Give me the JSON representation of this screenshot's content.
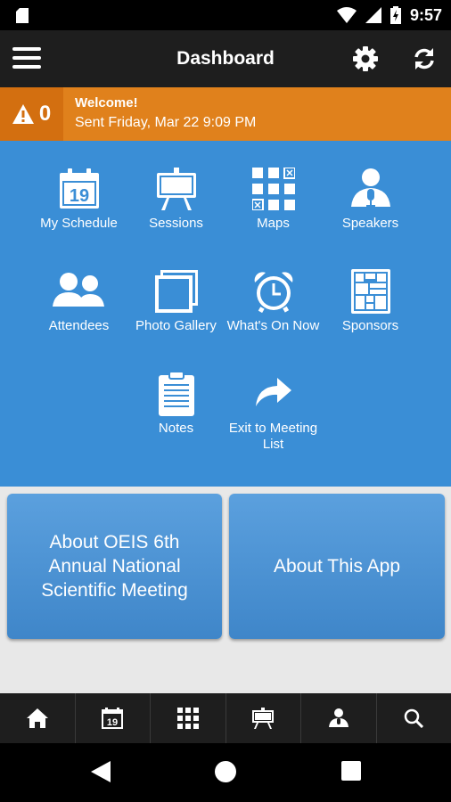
{
  "status_bar": {
    "time": "9:57"
  },
  "app_bar": {
    "title": "Dashboard"
  },
  "alert": {
    "count": "0",
    "title": "Welcome!",
    "subtitle": "Sent Friday, Mar 22 9:09 PM"
  },
  "grid": {
    "calendar_day": "19",
    "items": [
      {
        "label": "My Schedule"
      },
      {
        "label": "Sessions"
      },
      {
        "label": "Maps"
      },
      {
        "label": "Speakers"
      },
      {
        "label": "Attendees"
      },
      {
        "label": "Photo Gallery"
      },
      {
        "label": "What's On Now"
      },
      {
        "label": "Sponsors"
      },
      {
        "label": "Notes"
      },
      {
        "label": "Exit to Meeting List"
      }
    ]
  },
  "cards": [
    {
      "label": "About OEIS 6th Annual National Scientific Meeting"
    },
    {
      "label": "About This App"
    }
  ],
  "tab_bar": {
    "calendar_day": "19"
  },
  "colors": {
    "accent_blue": "#3a8ed6",
    "alert_orange": "#e0811c",
    "bar_dark": "#1e1e1e"
  }
}
